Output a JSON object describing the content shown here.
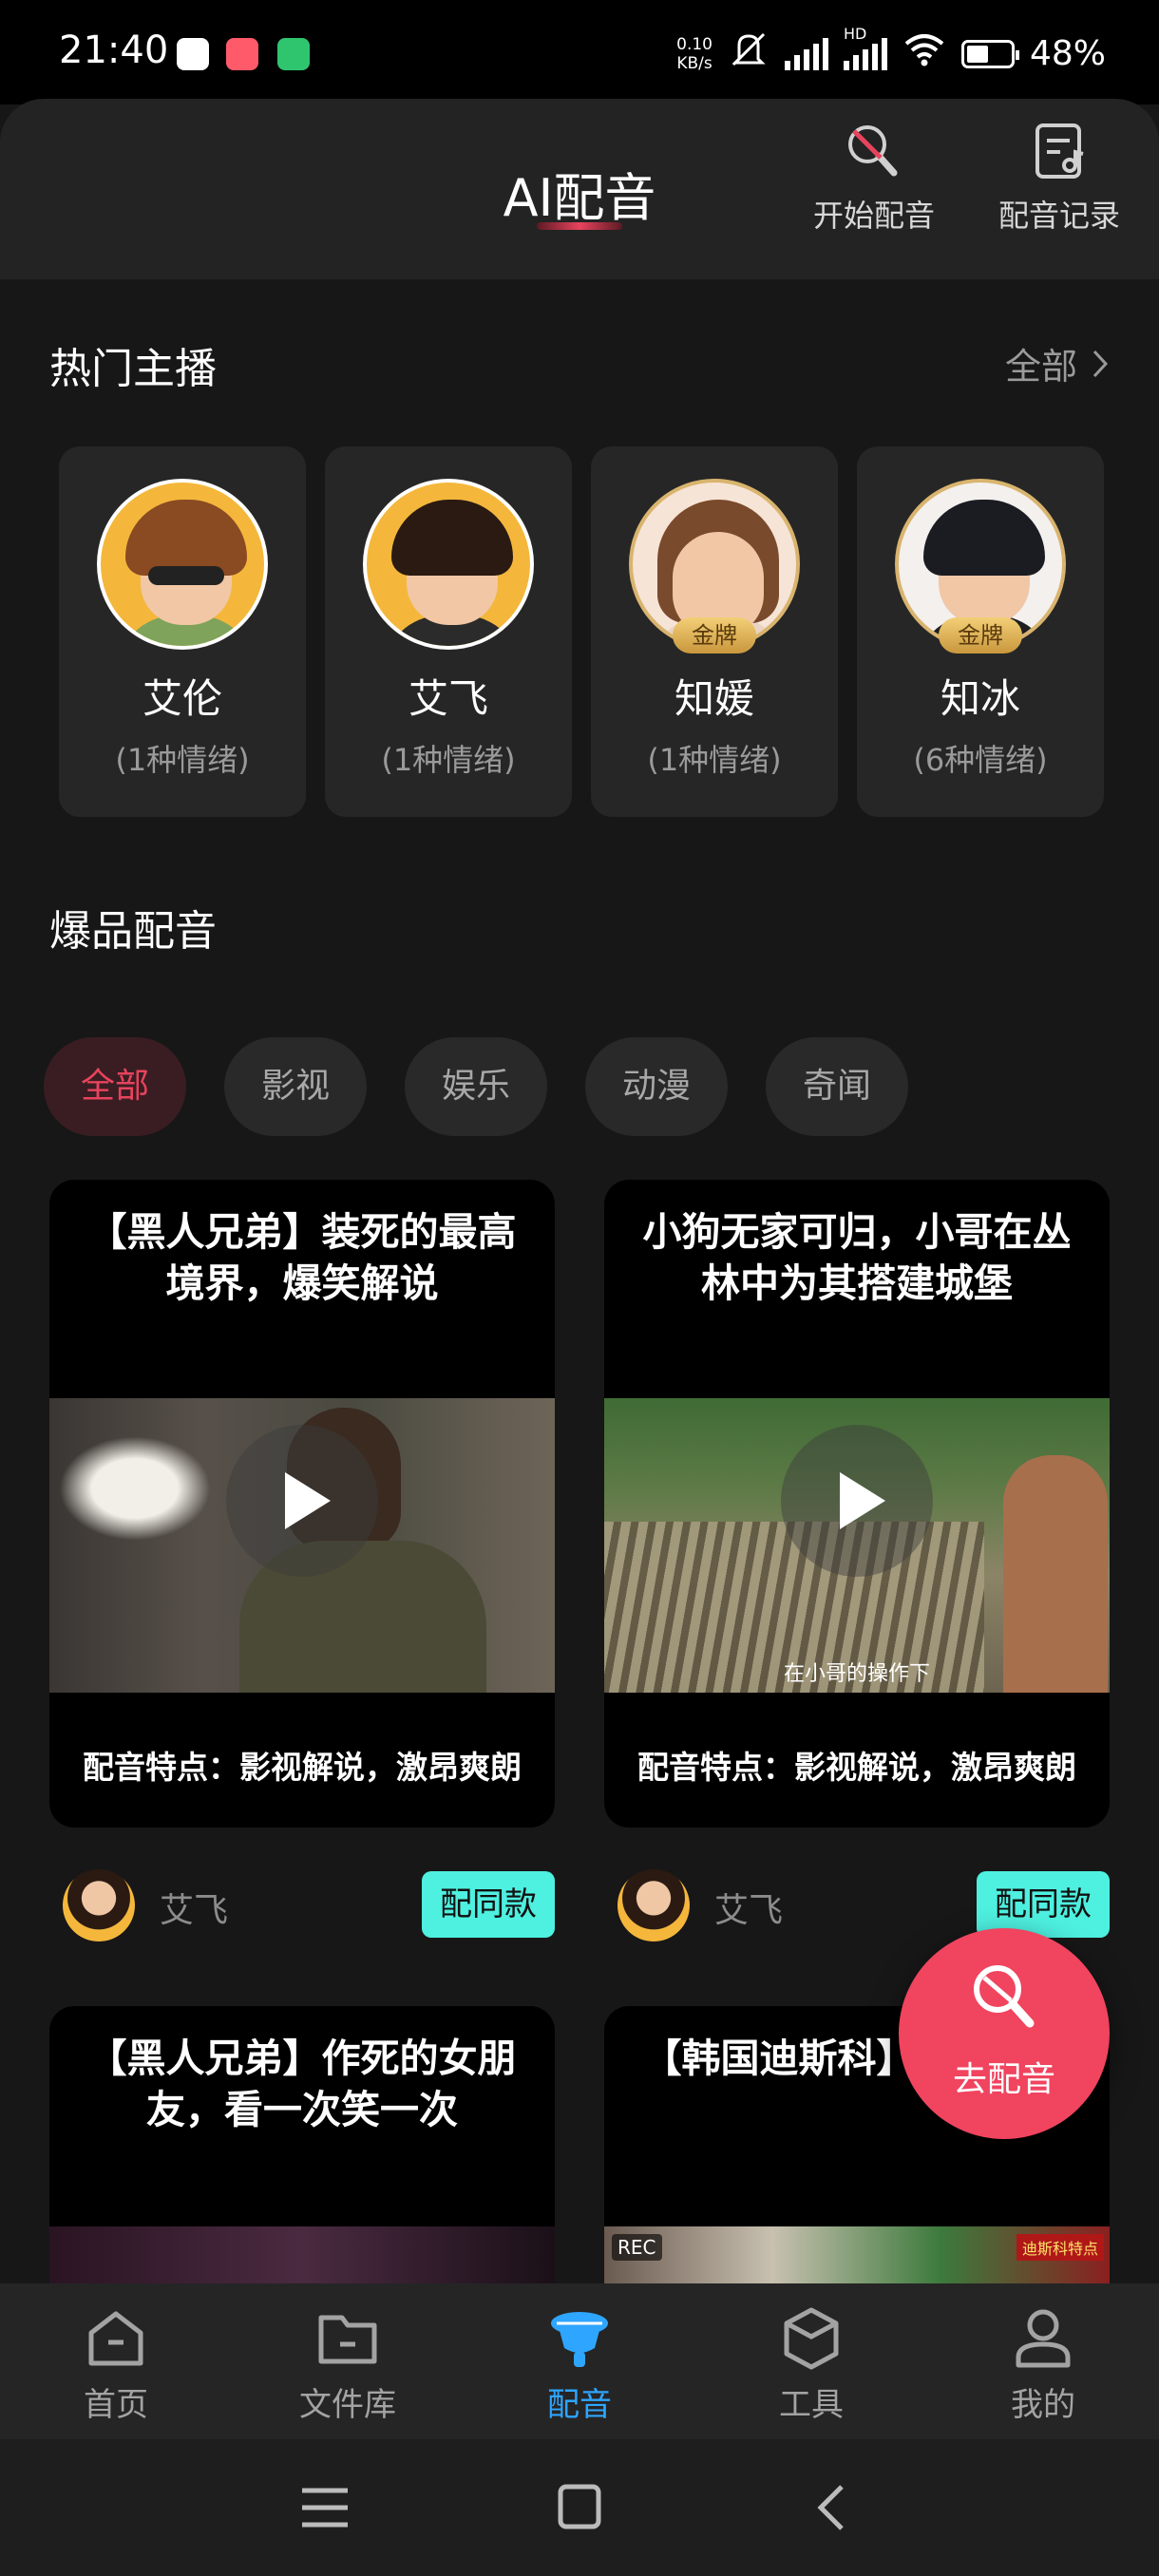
{
  "status_bar": {
    "time": "21:40",
    "net_speed_value": "0.10",
    "net_speed_unit": "KB/s",
    "hd_label": "HD",
    "battery": "48%"
  },
  "header": {
    "title": "AI配音",
    "start_dub_label": "开始配音",
    "dub_history_label": "配音记录"
  },
  "hot_anchors": {
    "title": "热门主播",
    "all_label": "全部",
    "items": [
      {
        "name": "艾伦",
        "emotions": "(1种情绪)",
        "badge": ""
      },
      {
        "name": "艾飞",
        "emotions": "(1种情绪)",
        "badge": ""
      },
      {
        "name": "知媛",
        "emotions": "(1种情绪)",
        "badge": "金牌"
      },
      {
        "name": "知冰",
        "emotions": "(6种情绪)",
        "badge": "金牌"
      }
    ]
  },
  "hot_dubs": {
    "title": "爆品配音",
    "filters": [
      "全部",
      "影视",
      "娱乐",
      "动漫",
      "奇闻"
    ],
    "active_filter": "全部",
    "cards": [
      {
        "title": "【黑人兄弟】装死的最高境界，爆笑解说",
        "feature": "配音特点：影视解说，激昂爽朗",
        "author": "艾飞",
        "action": "配同款",
        "caption": ""
      },
      {
        "title": "小狗无家可归，小哥在丛林中为其搭建城堡",
        "feature": "配音特点：影视解说，激昂爽朗",
        "author": "艾飞",
        "action": "配同款",
        "caption": "在小哥的操作下"
      },
      {
        "title": "【黑人兄弟】作死的女朋友，看一次笑一次",
        "feature": "",
        "author": "",
        "action": "",
        "caption": ""
      },
      {
        "title": "【韩国迪斯科】爆笑解说",
        "feature": "",
        "author": "",
        "action": "",
        "caption": "REC",
        "caption2": "迪斯科特点"
      }
    ]
  },
  "fab": {
    "label": "去配音"
  },
  "bottom_nav": {
    "items": [
      "首页",
      "文件库",
      "配音",
      "工具",
      "我的"
    ],
    "active": "配音"
  },
  "colors": {
    "accent": "#e8435d",
    "cyan_button": "#4ef0e0",
    "nav_active": "#2ea6ff",
    "background": "#171717"
  }
}
